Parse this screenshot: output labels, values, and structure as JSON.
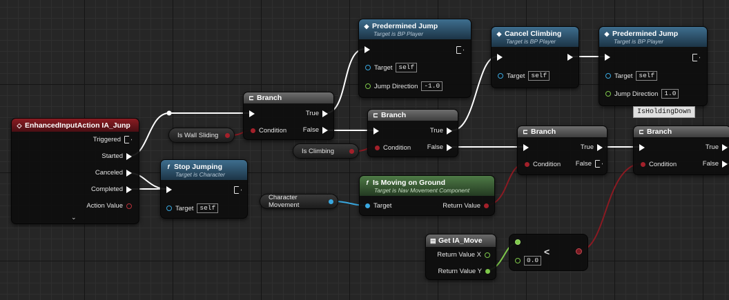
{
  "nodes": {
    "event": {
      "title": "EnhancedInputAction IA_Junp",
      "pins": [
        "Triggered",
        "Started",
        "Canceled",
        "Completed",
        "Action Value"
      ]
    },
    "branch1": {
      "title": "Branch",
      "condition": "Condition",
      "true": "True",
      "false": "False"
    },
    "branch2": {
      "title": "Branch",
      "condition": "Condition",
      "true": "True",
      "false": "False"
    },
    "branch3": {
      "title": "Branch",
      "condition": "Condition",
      "true": "True",
      "false": "False"
    },
    "branch4": {
      "title": "Branch",
      "condition": "Condition",
      "true": "True",
      "false": "False"
    },
    "predJump1": {
      "title": "Predermined Jump",
      "subtitle": "Target is BP Player",
      "target": "Target",
      "target_value": "self",
      "jump_dir": "Jump Direction",
      "jump_dir_value": "-1.0"
    },
    "predJump2": {
      "title": "Predermined Jump",
      "subtitle": "Target is BP Player",
      "target": "Target",
      "target_value": "self",
      "jump_dir": "Jump Direction",
      "jump_dir_value": "1.0"
    },
    "cancelClimb": {
      "title": "Cancel Climbing",
      "subtitle": "Target is BP Player",
      "target": "Target",
      "target_value": "self"
    },
    "stopJump": {
      "title": "Stop Jumping",
      "subtitle": "Target is Character",
      "target": "Target",
      "target_value": "self"
    },
    "isMoving": {
      "title": "Is Moving on Ground",
      "subtitle": "Target is Nav Movement Component",
      "target": "Target",
      "return": "Return Value"
    },
    "getMove": {
      "title": "Get IA_Move",
      "retx": "Return Value X",
      "rety": "Return Value Y"
    },
    "compare": {
      "op": "<",
      "value": "0.0"
    }
  },
  "variables": {
    "wallSliding": "Is Wall Sliding",
    "climbing": "Is Climbing",
    "charMove": "Character Movement"
  },
  "comment": "IsHoldingDown",
  "colors": {
    "exec": "#ffffff",
    "bool": "#a3202a",
    "object": "#39a8e0",
    "float": "#7ec84a"
  },
  "icons": {
    "event": "diamond-icon",
    "function": "f-icon",
    "branch": "branch-icon",
    "getter": "table-icon"
  }
}
